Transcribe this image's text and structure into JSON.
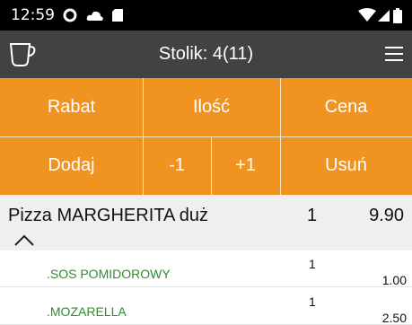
{
  "status_bar": {
    "time": "12:59",
    "icons": [
      "notification-dot-icon",
      "cloud-icon",
      "sd-card-icon",
      "wifi-icon",
      "signal-icon",
      "battery-icon"
    ]
  },
  "app_bar": {
    "title": "Stolik: 4(11)",
    "logo_icon": "cup-icon",
    "menu_icon": "hamburger-menu-icon"
  },
  "actions": {
    "rabat": "Rabat",
    "ilosc": "Ilość",
    "cena": "Cena",
    "dodaj": "Dodaj",
    "minus_one": "-1",
    "plus_one": "+1",
    "usun": "Usuń"
  },
  "order": {
    "items": [
      {
        "name": "Pizza MARGHERITA duż",
        "qty": "1",
        "price": "9.90",
        "addons": [
          {
            "name": ".SOS POMIDOROWY",
            "qty": "1",
            "price": "1.00"
          },
          {
            "name": ".MOZARELLA",
            "qty": "1",
            "price": "2.50"
          }
        ]
      }
    ]
  },
  "colors": {
    "accent": "#f19320",
    "app_bar": "#424242",
    "addon_text": "#2e8b2e"
  }
}
